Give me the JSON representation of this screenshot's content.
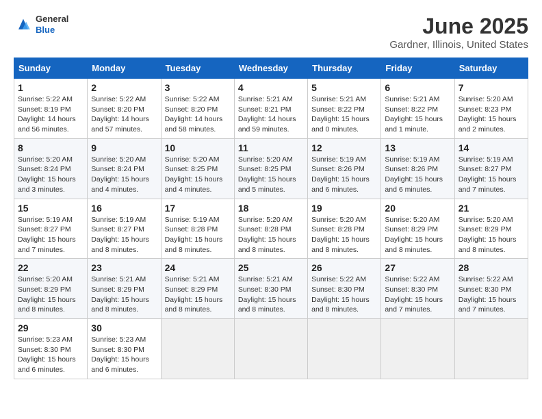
{
  "header": {
    "logo": {
      "general": "General",
      "blue": "Blue"
    },
    "title": "June 2025",
    "subtitle": "Gardner, Illinois, United States"
  },
  "calendar": {
    "days_of_week": [
      "Sunday",
      "Monday",
      "Tuesday",
      "Wednesday",
      "Thursday",
      "Friday",
      "Saturday"
    ],
    "weeks": [
      [
        {
          "day": null,
          "info": null
        },
        {
          "day": null,
          "info": null
        },
        {
          "day": null,
          "info": null
        },
        {
          "day": null,
          "info": null
        },
        {
          "day": "5",
          "info": "Sunrise: 5:21 AM\nSunset: 8:22 PM\nDaylight: 15 hours\nand 0 minutes."
        },
        {
          "day": "6",
          "info": "Sunrise: 5:21 AM\nSunset: 8:22 PM\nDaylight: 15 hours\nand 1 minute."
        },
        {
          "day": "7",
          "info": "Sunrise: 5:20 AM\nSunset: 8:23 PM\nDaylight: 15 hours\nand 2 minutes."
        }
      ],
      [
        {
          "day": "1",
          "info": "Sunrise: 5:22 AM\nSunset: 8:19 PM\nDaylight: 14 hours\nand 56 minutes."
        },
        {
          "day": "2",
          "info": "Sunrise: 5:22 AM\nSunset: 8:20 PM\nDaylight: 14 hours\nand 57 minutes."
        },
        {
          "day": "3",
          "info": "Sunrise: 5:22 AM\nSunset: 8:20 PM\nDaylight: 14 hours\nand 58 minutes."
        },
        {
          "day": "4",
          "info": "Sunrise: 5:21 AM\nSunset: 8:21 PM\nDaylight: 14 hours\nand 59 minutes."
        },
        {
          "day": "5",
          "info": "Sunrise: 5:21 AM\nSunset: 8:22 PM\nDaylight: 15 hours\nand 0 minutes."
        },
        {
          "day": "6",
          "info": "Sunrise: 5:21 AM\nSunset: 8:22 PM\nDaylight: 15 hours\nand 1 minute."
        },
        {
          "day": "7",
          "info": "Sunrise: 5:20 AM\nSunset: 8:23 PM\nDaylight: 15 hours\nand 2 minutes."
        }
      ],
      [
        {
          "day": "8",
          "info": "Sunrise: 5:20 AM\nSunset: 8:24 PM\nDaylight: 15 hours\nand 3 minutes."
        },
        {
          "day": "9",
          "info": "Sunrise: 5:20 AM\nSunset: 8:24 PM\nDaylight: 15 hours\nand 4 minutes."
        },
        {
          "day": "10",
          "info": "Sunrise: 5:20 AM\nSunset: 8:25 PM\nDaylight: 15 hours\nand 4 minutes."
        },
        {
          "day": "11",
          "info": "Sunrise: 5:20 AM\nSunset: 8:25 PM\nDaylight: 15 hours\nand 5 minutes."
        },
        {
          "day": "12",
          "info": "Sunrise: 5:19 AM\nSunset: 8:26 PM\nDaylight: 15 hours\nand 6 minutes."
        },
        {
          "day": "13",
          "info": "Sunrise: 5:19 AM\nSunset: 8:26 PM\nDaylight: 15 hours\nand 6 minutes."
        },
        {
          "day": "14",
          "info": "Sunrise: 5:19 AM\nSunset: 8:27 PM\nDaylight: 15 hours\nand 7 minutes."
        }
      ],
      [
        {
          "day": "15",
          "info": "Sunrise: 5:19 AM\nSunset: 8:27 PM\nDaylight: 15 hours\nand 7 minutes."
        },
        {
          "day": "16",
          "info": "Sunrise: 5:19 AM\nSunset: 8:27 PM\nDaylight: 15 hours\nand 8 minutes."
        },
        {
          "day": "17",
          "info": "Sunrise: 5:19 AM\nSunset: 8:28 PM\nDaylight: 15 hours\nand 8 minutes."
        },
        {
          "day": "18",
          "info": "Sunrise: 5:20 AM\nSunset: 8:28 PM\nDaylight: 15 hours\nand 8 minutes."
        },
        {
          "day": "19",
          "info": "Sunrise: 5:20 AM\nSunset: 8:28 PM\nDaylight: 15 hours\nand 8 minutes."
        },
        {
          "day": "20",
          "info": "Sunrise: 5:20 AM\nSunset: 8:29 PM\nDaylight: 15 hours\nand 8 minutes."
        },
        {
          "day": "21",
          "info": "Sunrise: 5:20 AM\nSunset: 8:29 PM\nDaylight: 15 hours\nand 8 minutes."
        }
      ],
      [
        {
          "day": "22",
          "info": "Sunrise: 5:20 AM\nSunset: 8:29 PM\nDaylight: 15 hours\nand 8 minutes."
        },
        {
          "day": "23",
          "info": "Sunrise: 5:21 AM\nSunset: 8:29 PM\nDaylight: 15 hours\nand 8 minutes."
        },
        {
          "day": "24",
          "info": "Sunrise: 5:21 AM\nSunset: 8:29 PM\nDaylight: 15 hours\nand 8 minutes."
        },
        {
          "day": "25",
          "info": "Sunrise: 5:21 AM\nSunset: 8:30 PM\nDaylight: 15 hours\nand 8 minutes."
        },
        {
          "day": "26",
          "info": "Sunrise: 5:22 AM\nSunset: 8:30 PM\nDaylight: 15 hours\nand 8 minutes."
        },
        {
          "day": "27",
          "info": "Sunrise: 5:22 AM\nSunset: 8:30 PM\nDaylight: 15 hours\nand 7 minutes."
        },
        {
          "day": "28",
          "info": "Sunrise: 5:22 AM\nSunset: 8:30 PM\nDaylight: 15 hours\nand 7 minutes."
        }
      ],
      [
        {
          "day": "29",
          "info": "Sunrise: 5:23 AM\nSunset: 8:30 PM\nDaylight: 15 hours\nand 6 minutes."
        },
        {
          "day": "30",
          "info": "Sunrise: 5:23 AM\nSunset: 8:30 PM\nDaylight: 15 hours\nand 6 minutes."
        },
        {
          "day": null,
          "info": null
        },
        {
          "day": null,
          "info": null
        },
        {
          "day": null,
          "info": null
        },
        {
          "day": null,
          "info": null
        },
        {
          "day": null,
          "info": null
        }
      ]
    ]
  }
}
